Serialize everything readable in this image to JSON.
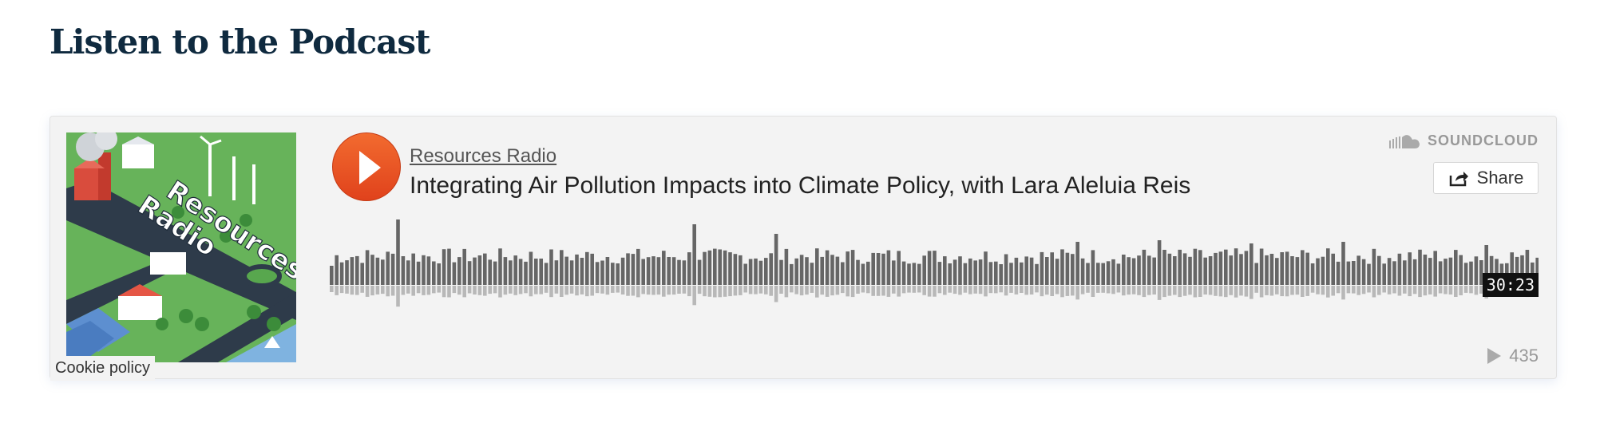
{
  "page": {
    "heading": "Listen to the Podcast"
  },
  "player": {
    "uploader": "Resources Radio",
    "title": "Integrating Air Pollution Impacts into Climate Policy, with Lara Aleluia Reis",
    "brand": "SOUNDCLOUD",
    "share_label": "Share",
    "duration": "30:23",
    "plays": "435",
    "cookie_label": "Cookie policy",
    "artwork_text": [
      "Resources",
      "Radio"
    ],
    "accent_color": "#f05a24"
  }
}
